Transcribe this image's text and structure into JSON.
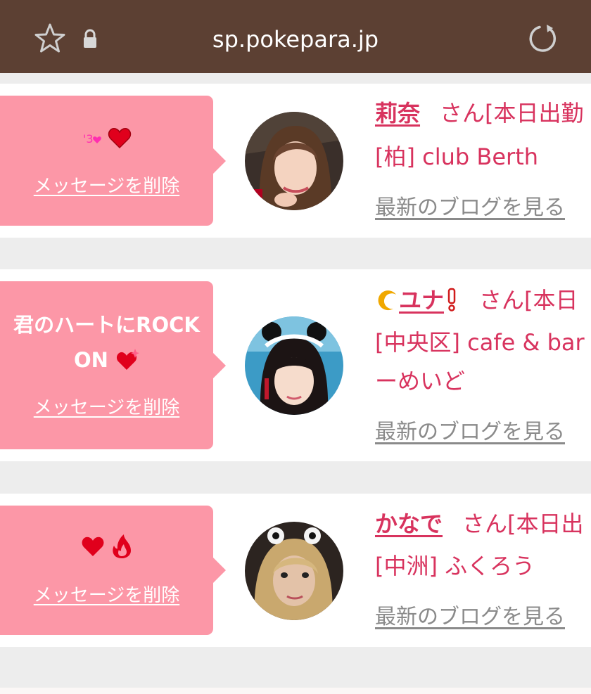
{
  "browser": {
    "url": "sp.pokepara.jp"
  },
  "actions": {
    "delete_label": "メッセージを削除",
    "blog_label": "最新のブログを見る"
  },
  "cards": [
    {
      "message": "",
      "name": "莉奈",
      "status": "さん[本日出勤",
      "area_shop_line1": "[柏] club Berth",
      "area_shop_line2": ""
    },
    {
      "message_line1": "君のハートにROCK",
      "message_line2": "ON",
      "name": "ユナ",
      "status": "さん[本日",
      "area_shop_line1": "[中央区] cafe & bar",
      "area_shop_line2": "ーめいど"
    },
    {
      "message": "",
      "name": "かなで",
      "status": "さん[本日出",
      "area_shop_line1": "[中洲] ふくろう",
      "area_shop_line2": ""
    }
  ]
}
